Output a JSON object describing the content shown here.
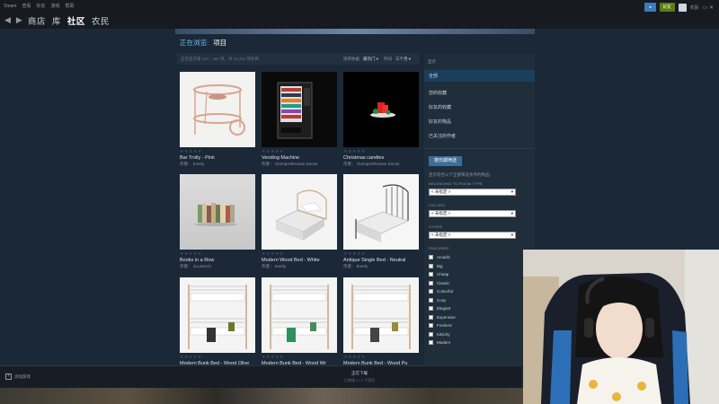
{
  "menubar": {
    "items": [
      "Steam",
      "查看",
      "好友",
      "游戏",
      "帮助"
    ]
  },
  "topright": {
    "notify_label": "",
    "green_label": "好友",
    "user_label": "农民",
    "window_controls": "▭  ✕"
  },
  "nav": {
    "back": "◀",
    "forward": "▶",
    "links": [
      "商店",
      "库",
      "社区",
      "农民"
    ],
    "active_index": 2
  },
  "breadcrumb": {
    "section": "正在浏览:",
    "current": "项目"
  },
  "results": {
    "count_text": "正在显示第 121 - 150 项，共 14,211 项条目",
    "sort_label": "排序依据",
    "sort_value": "最热门 ▾",
    "time_label": "时间",
    "time_value": "三个月 ▾"
  },
  "items": [
    {
      "title": "Bar Trolly - Pink",
      "author": "作者： Everly",
      "stars": "★★★★★"
    },
    {
      "title": "Vending Machine",
      "author": "作者： chompzel/House Doctor",
      "stars": "★★★★★"
    },
    {
      "title": "Christmas candles",
      "author": "作者： chompzel/House Doctor",
      "stars": "★★★★★"
    },
    {
      "title": "Books in a Row",
      "author": "作者： zLLamzzz",
      "stars": "★★★★★"
    },
    {
      "title": "Modern Wood Bed - White",
      "author": "作者： Everly",
      "stars": "★★★★★"
    },
    {
      "title": "Antique Single Bed - Neutral",
      "author": "作者： Everly",
      "stars": "★★★★★"
    },
    {
      "title": "Modern Bunk Bed - Wood Olive",
      "author": "",
      "stars": "★★★★★"
    },
    {
      "title": "Modern Bunk Bed - Wood Wr",
      "author": "",
      "stars": "★★★★★"
    },
    {
      "title": "Modern Bunk Bed - Wood Pu",
      "author": "",
      "stars": "★★★★★"
    }
  ],
  "filter": {
    "show_label": "显示",
    "all_label": "全部",
    "links": [
      "您的收藏",
      "好友的收藏",
      "好友的物品",
      "已关注的作者"
    ],
    "apply_button": "按日期筛选",
    "hint": "显示符合以下全部筛选条件的物品：",
    "groups": [
      {
        "heading": "BELONGING TO ROOM TYPE",
        "value": "< 未指定 >"
      },
      {
        "heading": "COLORS",
        "value": "< 未指定 >"
      },
      {
        "heading": "OTHER",
        "value": "< 未指定 >"
      }
    ],
    "features_heading": "FEATURES",
    "features": [
      "Arcadic",
      "Big",
      "Cheap",
      "Classic",
      "Colourful",
      "Cosy",
      "Elegant",
      "Expensive",
      "FreshAir",
      "Kitschy",
      "Modern"
    ]
  },
  "bottombar": {
    "add_label": "添加游戏",
    "plus": "+",
    "center_title": "正在下载",
    "center_sub": "已完成 1 / 1 个项目"
  },
  "colors": {
    "bg": "#1b2838",
    "nav_bg": "#171a21",
    "accent": "#66c0f4",
    "selected": "#1a3f5c"
  }
}
